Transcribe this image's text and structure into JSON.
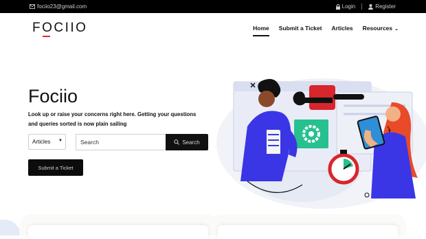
{
  "topbar": {
    "email": "fociio23@gmail.com",
    "login": "Login",
    "register": "Register",
    "icons": {
      "email": "envelope-icon",
      "login": "lock-icon",
      "register": "user-icon"
    }
  },
  "header": {
    "logo": "FOCIIO",
    "nav": [
      {
        "label": "Home",
        "active": true
      },
      {
        "label": "Submit a Ticket"
      },
      {
        "label": "Articles"
      },
      {
        "label": "Resources",
        "dropdown": true
      }
    ]
  },
  "hero": {
    "title": "Fociio",
    "subtitle": "Look up or raise your concerns right here. Getting your questions and queries sorted is now plain sailing",
    "category_select": {
      "value": "Articles"
    },
    "search": {
      "placeholder": "Search",
      "button_label": "Search"
    },
    "ticket_button": "Submit a Ticket"
  },
  "colors": {
    "topbar_bg": "#000000",
    "accent_red": "#e0292c",
    "button_dark": "#111111",
    "illustration_blue": "#3b3ae0",
    "illustration_orange": "#e84a2a",
    "illustration_teal": "#2bbf9c"
  }
}
